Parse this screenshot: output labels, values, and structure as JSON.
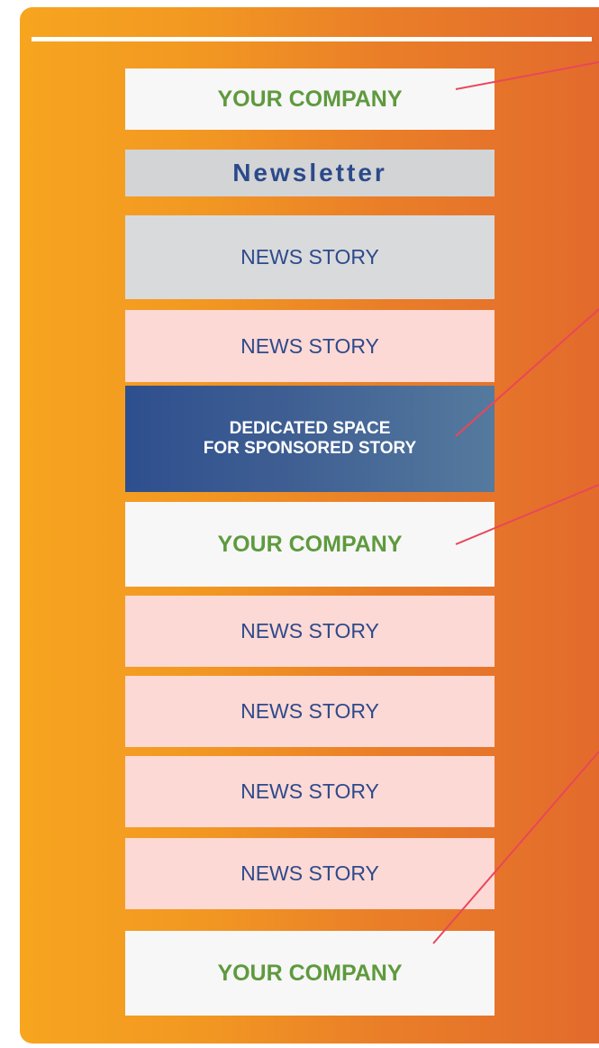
{
  "blocks": {
    "company_1": "YOUR COMPANY",
    "newsletter": "Newsletter",
    "story_1": "NEWS STORY",
    "story_2": "NEWS STORY",
    "sponsored_line_1": "DEDICATED SPACE",
    "sponsored_line_2": "FOR SPONSORED STORY",
    "company_2": "YOUR COMPANY",
    "story_3": "NEWS STORY",
    "story_4": "NEWS STORY",
    "story_5": "NEWS STORY",
    "story_6": "NEWS STORY",
    "company_3": "YOUR COMPANY"
  },
  "colors": {
    "panel_gradient_start": "#f7a51f",
    "panel_gradient_end": "#e2692c",
    "company_text": "#5e9a3e",
    "story_text": "#2e4a8c",
    "pink_block": "#fcd9d4",
    "grey_block": "#d9dadc",
    "callout_line": "#e8475a"
  }
}
